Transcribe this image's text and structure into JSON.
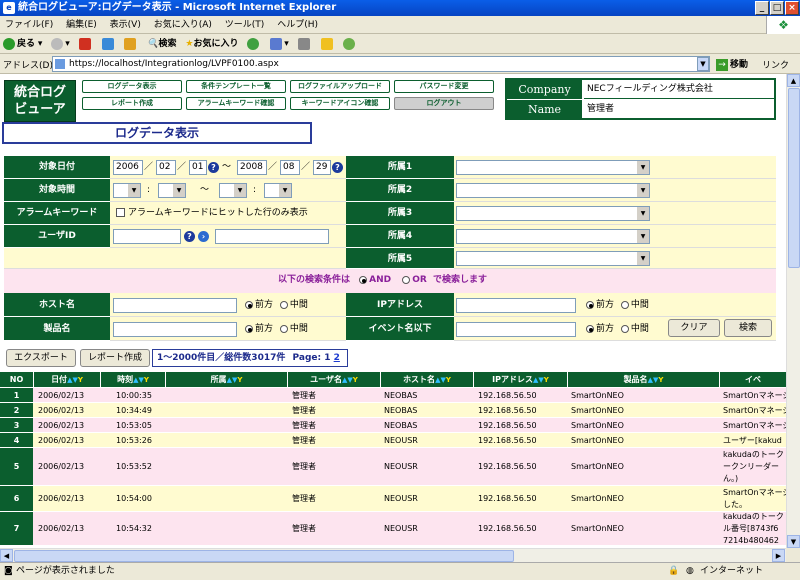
{
  "window": {
    "title": "統合ログビューア:ログデータ表示 - Microsoft Internet Explorer",
    "min": "_",
    "max": "□",
    "close": "×"
  },
  "menu": [
    "ファイル(F)",
    "編集(E)",
    "表示(V)",
    "お気に入り(A)",
    "ツール(T)",
    "ヘルプ(H)"
  ],
  "toolbar": {
    "back": "戻る",
    "search": "検索",
    "favorites": "お気に入り"
  },
  "address": {
    "label": "アドレス(D)",
    "url": "https://localhost/Integrationlog/LVPF0100.aspx",
    "go": "移動",
    "links": "リンク"
  },
  "status": {
    "text": "ページが表示されました",
    "zone": "インターネット"
  },
  "app": {
    "logo_line1": "統合ログ",
    "logo_line2": "ビューア"
  },
  "nav": [
    {
      "label": "ログデータ表示"
    },
    {
      "label": "条件テンプレート一覧"
    },
    {
      "label": "ログファイルアップロード"
    },
    {
      "label": "パスワード変更"
    },
    {
      "label": "レポート作成"
    },
    {
      "label": "アラームキーワード確認"
    },
    {
      "label": "キーワードアイコン確認"
    },
    {
      "label": "ログアウト"
    }
  ],
  "info": {
    "company_label": "Company",
    "company_value": "NECフィールディング株式会社",
    "name_label": "Name",
    "name_value": "管理者"
  },
  "page_title": "ログデータ表示",
  "form": {
    "date_label": "対象日付",
    "date_from": {
      "y": "2006",
      "m": "02",
      "d": "01"
    },
    "date_to": {
      "y": "2008",
      "m": "08",
      "d": "29"
    },
    "sep": "／",
    "tilde": "～",
    "colon": ":",
    "time_label": "対象時間",
    "alarm_label": "アラームキーワード",
    "alarm_check": "アラームキーワードにヒットした行のみ表示",
    "user_label": "ユーザID",
    "user_value": "",
    "user_value2": "",
    "dept1": "所属1",
    "dept2": "所属2",
    "dept3": "所属3",
    "dept4": "所属4",
    "dept5": "所属5",
    "cond_text": "以下の検索条件は",
    "and": "AND",
    "or": "OR",
    "cond_suffix": "で検索します",
    "host_label": "ホスト名",
    "product_label": "製品名",
    "ip_label": "IPアドレス",
    "event_label": "イベント名以下",
    "front": "前方",
    "middle": "中間",
    "clear": "クリア",
    "search": "検索"
  },
  "actions": {
    "export": "エクスポート",
    "report": "レポート作成"
  },
  "pager": {
    "text": "1～2000件目／総件数3017件",
    "page_label": "Page: 1",
    "page2": "2"
  },
  "table": {
    "headers": [
      "NO",
      "日付",
      "時刻",
      "所属",
      "ユーザ名",
      "ホスト名",
      "IPアドレス",
      "製品名",
      "イベ"
    ],
    "rows": [
      {
        "no": "1",
        "date": "2006/02/13",
        "time": "10:00:35",
        "dept": "",
        "user": "管理者",
        "host": "NEOBAS",
        "ip": "192.168.56.50",
        "product": "SmartOnNEO",
        "event": [
          "SmartOnマネージ"
        ]
      },
      {
        "no": "2",
        "date": "2006/02/13",
        "time": "10:34:49",
        "dept": "",
        "user": "管理者",
        "host": "NEOBAS",
        "ip": "192.168.56.50",
        "product": "SmartOnNEO",
        "event": [
          "SmartOnマネージ"
        ]
      },
      {
        "no": "3",
        "date": "2006/02/13",
        "time": "10:53:05",
        "dept": "",
        "user": "管理者",
        "host": "NEOBAS",
        "ip": "192.168.56.50",
        "product": "SmartOnNEO",
        "event": [
          "SmartOnマネージ"
        ]
      },
      {
        "no": "4",
        "date": "2006/02/13",
        "time": "10:53:26",
        "dept": "",
        "user": "管理者",
        "host": "NEOUSR",
        "ip": "192.168.56.50",
        "product": "SmartOnNEO",
        "event": [
          "ユーザー[kakud"
        ]
      },
      {
        "no": "5",
        "date": "2006/02/13",
        "time": "10:53:52",
        "dept": "",
        "user": "管理者",
        "host": "NEOUSR",
        "ip": "192.168.56.50",
        "product": "SmartOnNEO",
        "event": [
          "kakudaのトーク",
          "ークンリーダー",
          "ん。)"
        ]
      },
      {
        "no": "6",
        "date": "2006/02/13",
        "time": "10:54:00",
        "dept": "",
        "user": "管理者",
        "host": "NEOUSR",
        "ip": "192.168.56.50",
        "product": "SmartOnNEO",
        "event": [
          "SmartOnマネージ",
          "した。"
        ]
      },
      {
        "no": "7",
        "date": "2006/02/13",
        "time": "10:54:32",
        "dept": "",
        "user": "管理者",
        "host": "NEOUSR",
        "ip": "192.168.56.50",
        "product": "SmartOnNEO",
        "event": [
          "kakudaのトーク",
          "ル番号[8743f6",
          "7214b480462"
        ]
      }
    ]
  }
}
